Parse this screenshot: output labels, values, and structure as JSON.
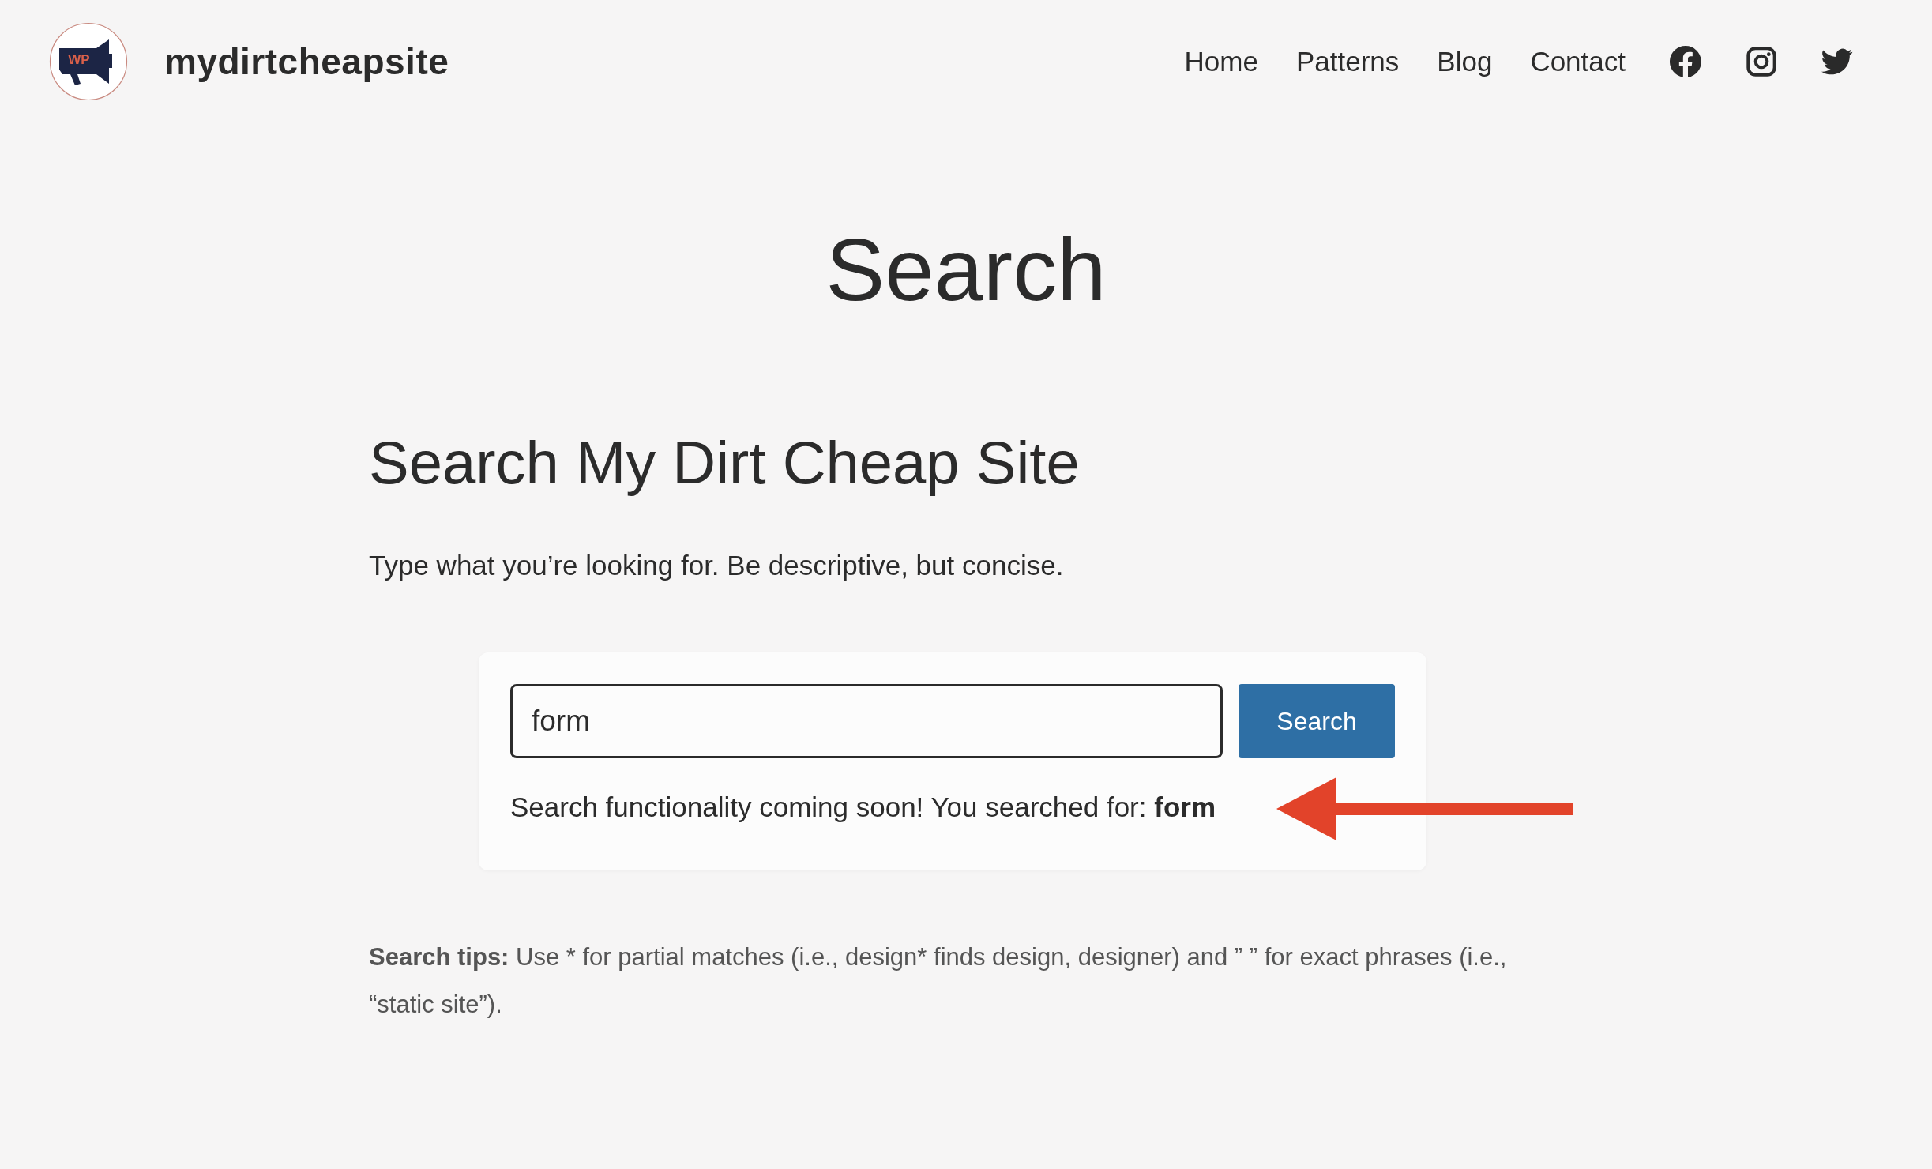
{
  "header": {
    "logo_text": "WP",
    "site_name": "mydirtcheapsite",
    "nav": [
      "Home",
      "Patterns",
      "Blog",
      "Contact"
    ],
    "social": [
      {
        "kind": "facebook"
      },
      {
        "kind": "instagram"
      },
      {
        "kind": "twitter"
      }
    ]
  },
  "page_title": "Search",
  "heading": "Search My Dirt Cheap Site",
  "intro": "Type what you’re looking for. Be descriptive, but concise.",
  "search": {
    "value": "form",
    "button": "Search",
    "result_prefix": "Search functionality coming soon! You searched for:",
    "result_query": "form"
  },
  "tips": {
    "label": "Search tips:",
    "text": "Use * for partial matches (i.e., design* finds design, designer) and ” ” for exact phrases (i.e., “static site”)."
  }
}
